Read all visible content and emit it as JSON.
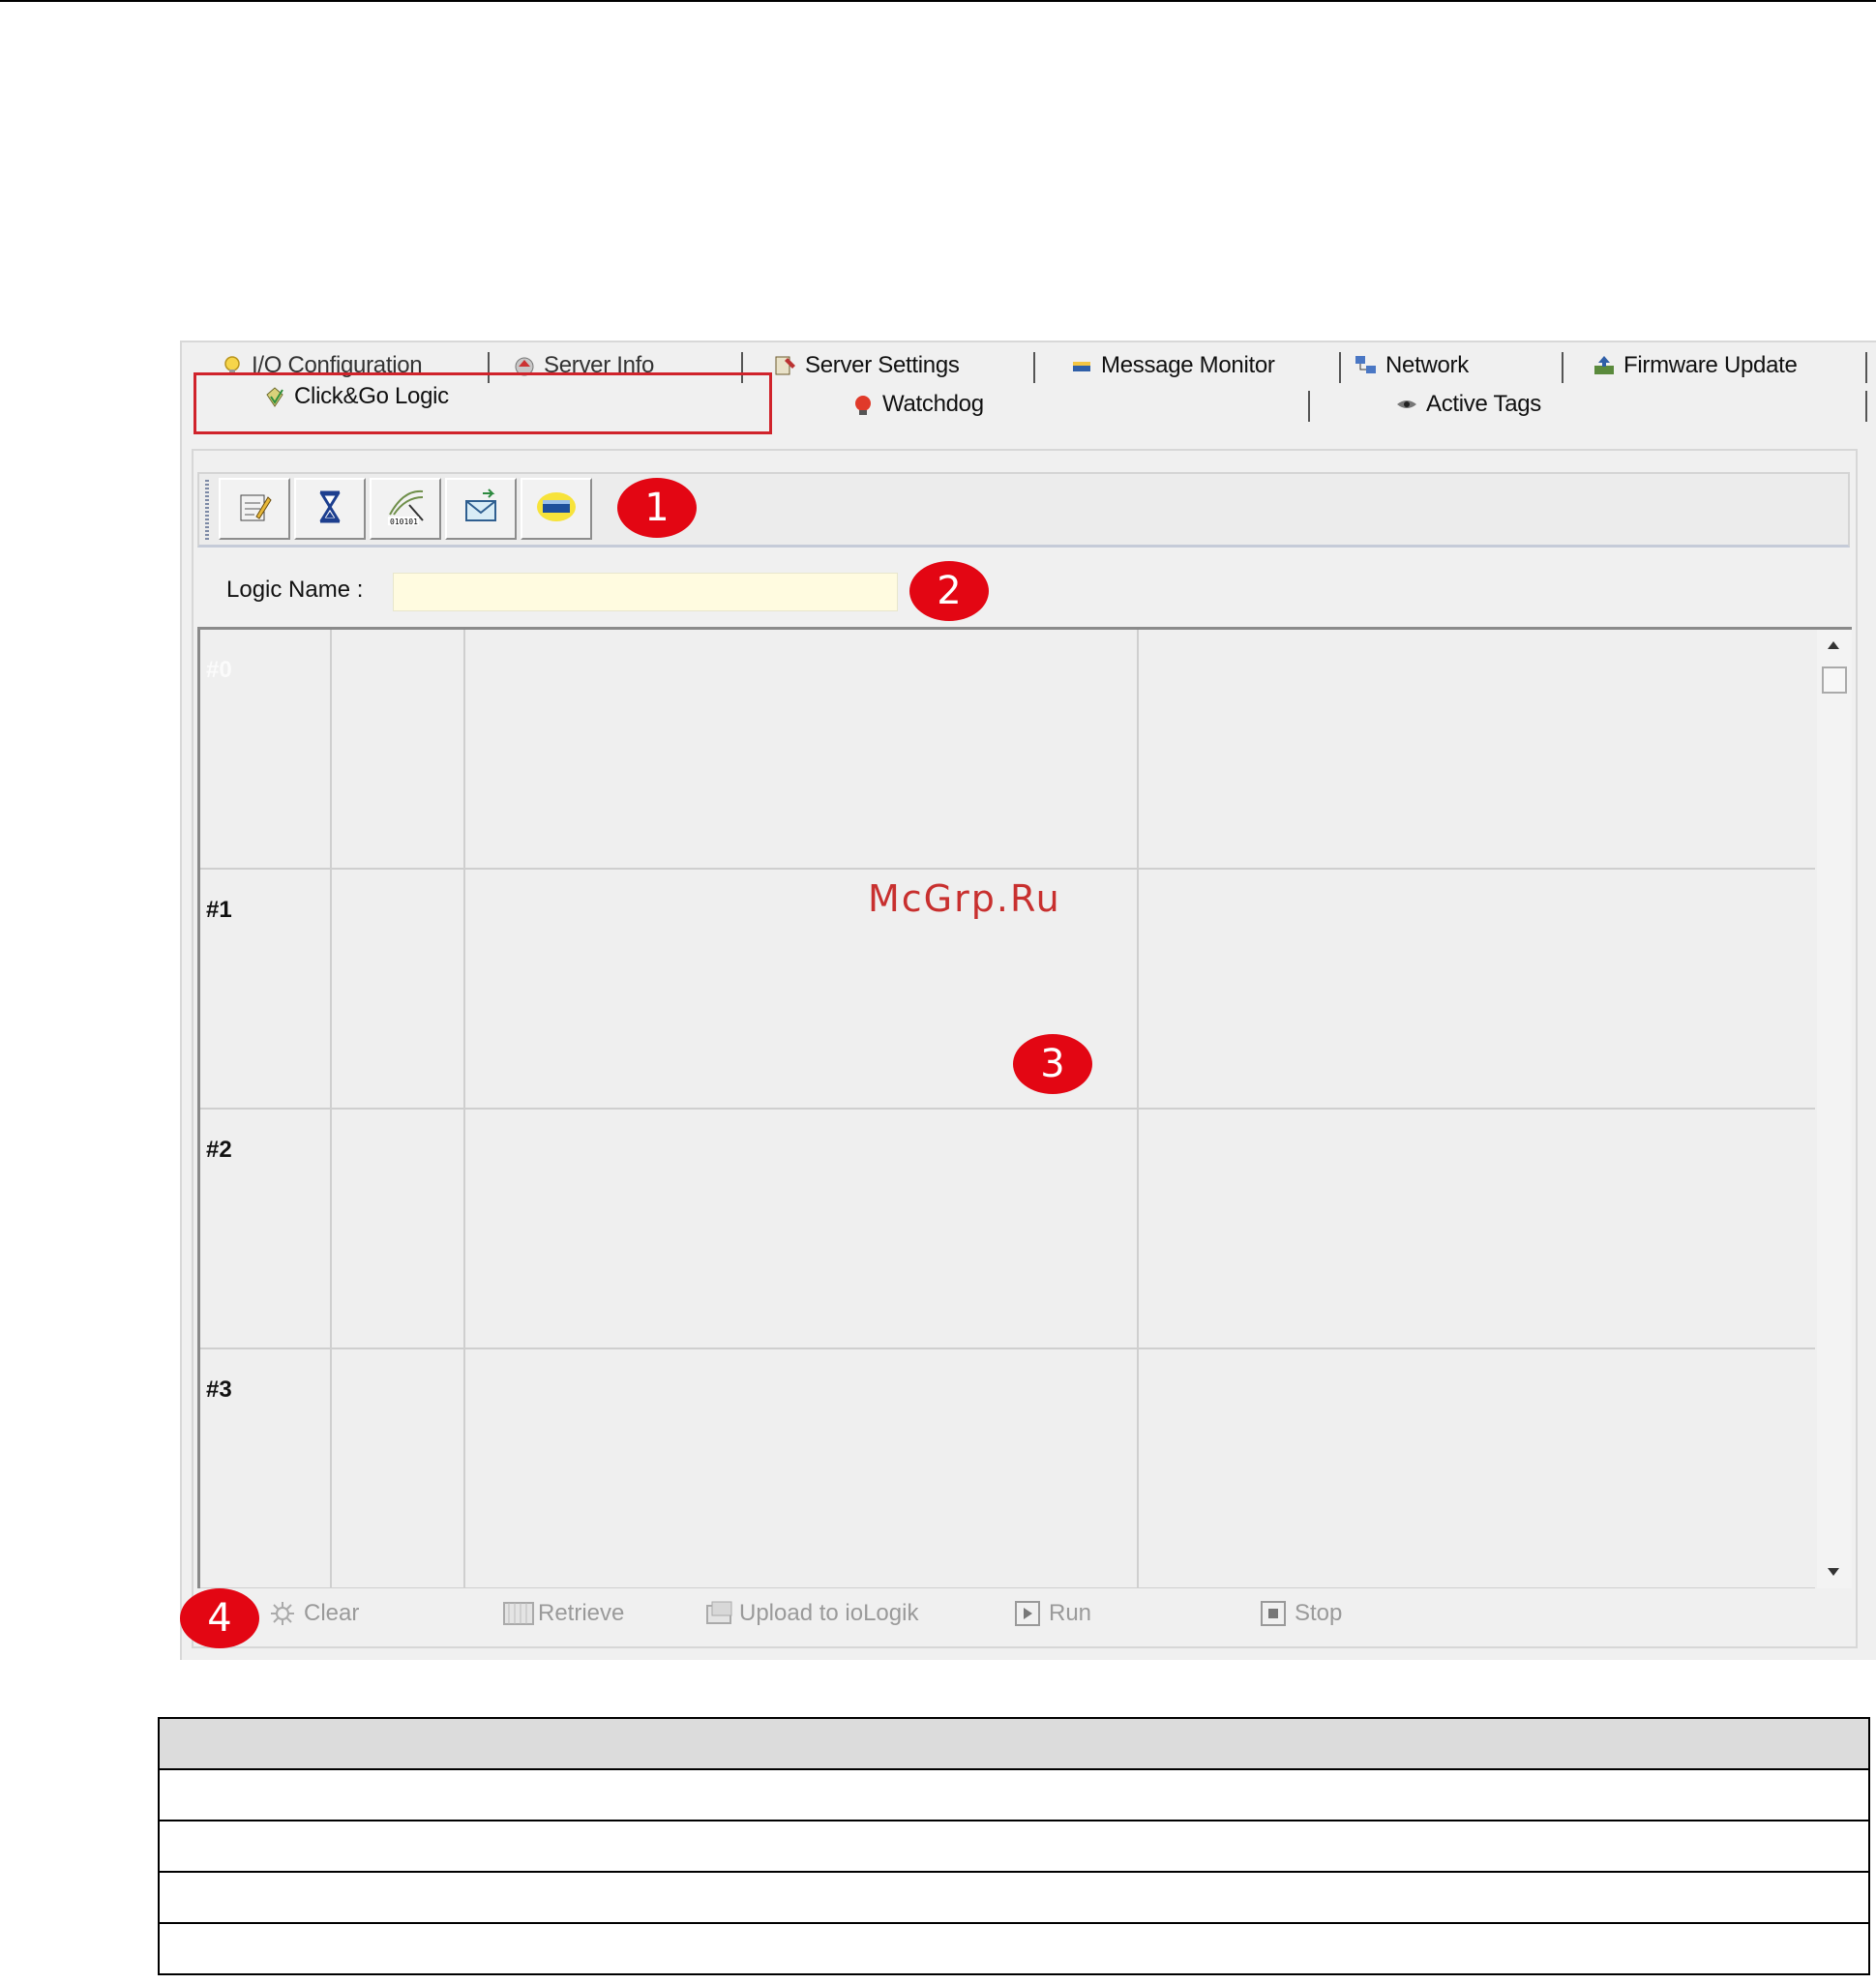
{
  "tabs_row1": [
    {
      "label": "I/O Configuration",
      "icon": "bulb-icon"
    },
    {
      "label": "Server Info",
      "icon": "server-info-icon"
    },
    {
      "label": "Server Settings",
      "icon": "server-settings-icon"
    },
    {
      "label": "Message Monitor",
      "icon": "message-monitor-icon"
    },
    {
      "label": "Network",
      "icon": "network-icon"
    },
    {
      "label": "Firmware Update",
      "icon": "firmware-update-icon"
    }
  ],
  "tabs_row2": [
    {
      "label": "Click&Go Logic",
      "icon": "clickgo-logic-icon",
      "active": true
    },
    {
      "label": "Watchdog",
      "icon": "watchdog-icon"
    },
    {
      "label": "Active Tags",
      "icon": "active-tags-icon"
    }
  ],
  "toolbar": {
    "buttons": [
      {
        "name": "edit-button",
        "icon": "notepad-pencil-icon"
      },
      {
        "name": "timer-button",
        "icon": "hourglass-icon"
      },
      {
        "name": "binary-button",
        "icon": "binary-signal-icon"
      },
      {
        "name": "mail-button",
        "icon": "mail-icon"
      },
      {
        "name": "snmp-button",
        "icon": "sun-card-icon"
      }
    ]
  },
  "logic_name": {
    "label": "Logic Name :",
    "value": ""
  },
  "grid": {
    "rows": [
      {
        "label": "#0"
      },
      {
        "label": "#1"
      },
      {
        "label": "#2"
      },
      {
        "label": "#3"
      }
    ]
  },
  "actions": [
    {
      "label": "Clear",
      "icon": "clear-icon"
    },
    {
      "label": "Retrieve",
      "icon": "retrieve-icon"
    },
    {
      "label": "Upload to ioLogik",
      "icon": "upload-icon"
    },
    {
      "label": "Run",
      "icon": "run-icon"
    },
    {
      "label": "Stop",
      "icon": "stop-icon"
    }
  ],
  "callouts": [
    "1",
    "2",
    "3",
    "4"
  ],
  "watermark": "McGrp.Ru",
  "colors": {
    "callout": "#e30613",
    "highlight": "#d0232b",
    "input_bg": "#fffbe0"
  }
}
